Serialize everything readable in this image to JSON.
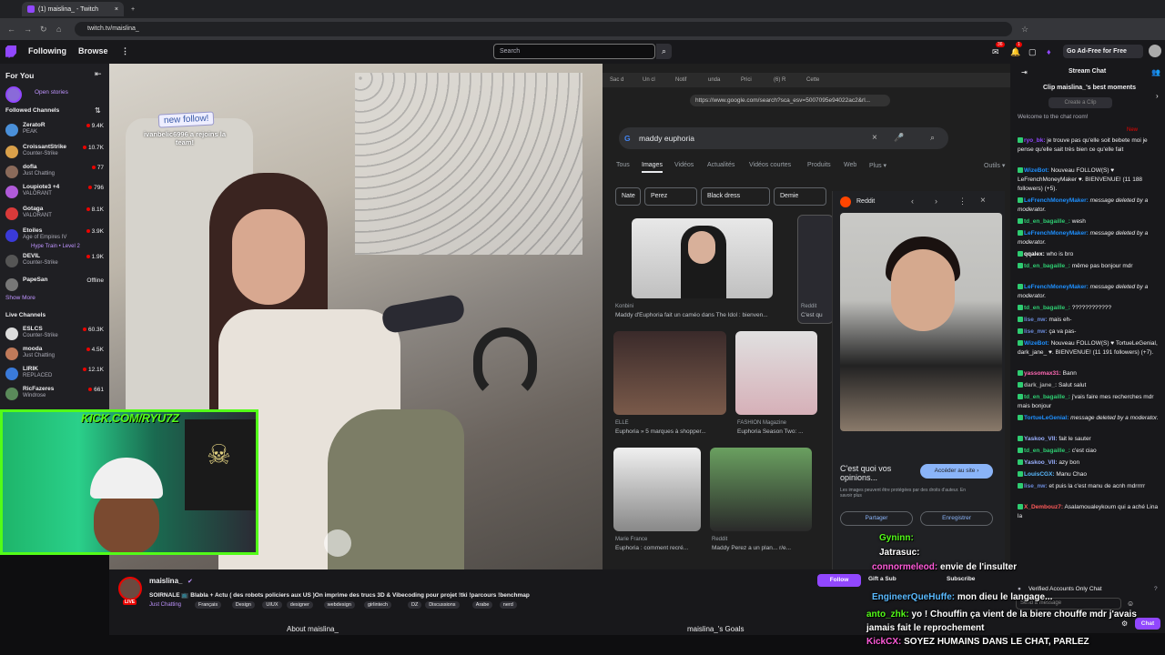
{
  "browser": {
    "tab_title": "(1) maislina_ - Twitch",
    "url": "twitch.tv/maislina_"
  },
  "twitch_nav": {
    "following": "Following",
    "browse": "Browse",
    "search_placeholder": "Search",
    "notif_count": "36",
    "notif_count2": "1",
    "adfree": "Go Ad-Free for Free"
  },
  "sidebar": {
    "for_you": "For You",
    "open_stories": "Open stories",
    "followed_header": "Followed Channels",
    "followed": [
      {
        "name": "ZeratoR",
        "game": "PEAK",
        "viewers": "9.4K",
        "color": "#4a90d9"
      },
      {
        "name": "CroissantStrike",
        "game": "Counter-Strike",
        "viewers": "10.7K",
        "color": "#d9a04a"
      },
      {
        "name": "dofla",
        "game": "Just Chatting",
        "viewers": "77",
        "color": "#8a6a5a"
      },
      {
        "name": "Loupiote3 +4",
        "game": "VALORANT",
        "viewers": "796",
        "color": "#b05ad9"
      },
      {
        "name": "Gotaga",
        "game": "VALORANT",
        "viewers": "8.1K",
        "color": "#d93a3a"
      },
      {
        "name": "Etoiles",
        "game": "Age of Empires IV",
        "viewers": "3.9K",
        "color": "#3a3ad9"
      },
      {
        "name": "DEVIL",
        "game": "Counter-Strike",
        "viewers": "1.9K",
        "color": "#555555"
      },
      {
        "name": "PapeSan",
        "game": "",
        "viewers": "Offline",
        "color": "#777777"
      }
    ],
    "hype_train": "Hype Train • Level 2",
    "show_more": "Show More",
    "live_header": "Live Channels",
    "live": [
      {
        "name": "ESLCS",
        "game": "Counter-Strike",
        "viewers": "60.3K",
        "color": "#dddddd"
      },
      {
        "name": "mooda",
        "game": "Just Chatting",
        "viewers": "4.5K",
        "color": "#c07a5a"
      },
      {
        "name": "LIRIK",
        "game": "REPLACED",
        "viewers": "12.1K",
        "color": "#3a7ad9"
      },
      {
        "name": "RicFazeres",
        "game": "Windrose",
        "viewers": "661",
        "color": "#5a8a5a"
      }
    ]
  },
  "stream_overlay": {
    "new_follow": "new follow!",
    "follow_note": "ivanbelic6996 a rejoins la team!"
  },
  "shared_screen": {
    "tabs": [
      "Sac d",
      "Un cl",
      "Notif",
      "unda",
      "Prici",
      "(6) R",
      "Cette"
    ],
    "url": "https://www.google.com/search?sca_esv=5007095e94022ac2&rl...",
    "query": "maddy euphoria",
    "gtabs": [
      "Tous",
      "Images",
      "Vidéos",
      "Actualités",
      "Vidéos courtes",
      "Produits",
      "Web",
      "Plus ▾",
      "Outils ▾"
    ],
    "chips": [
      "Nate",
      "Perez",
      "Black dress",
      "Demie"
    ],
    "results": [
      {
        "source": "Konbini",
        "caption": "Maddy d'Euphoria fait un caméo dans The Idol : bienven..."
      },
      {
        "source": "ELLE",
        "caption": "Euphoria » 5 marques à shopper..."
      },
      {
        "source": "FASHION Magazine",
        "caption": "Euphoria Season Two: ..."
      },
      {
        "source": "Marie France",
        "caption": "Euphoria : comment recré..."
      },
      {
        "source": "Reddit",
        "caption": "Maddy Perez a un plan... r/e..."
      }
    ],
    "side_source": "Reddit",
    "side_snip": "C'est qu",
    "panel_source": "Reddit",
    "opinion_title": "C'est quoi vos opinions...",
    "visit_site": "Accéder au site ›",
    "copyright": "Les images peuvent être protégées par des droits d'auteur. En savoir plus",
    "share": "Partager",
    "save": "Enregistrer"
  },
  "chat": {
    "header": "Stream Chat",
    "clip_banner": "Clip maislina_'s best moments",
    "create_clip": "Create a Clip",
    "welcome": "Welcome to the chat room!",
    "new_label": "New",
    "messages": [
      {
        "user": "ryo_bk:",
        "color": "#9147ff",
        "text": "je trouve pas qu'elle soit bebete moi je pense qu'elle sait très bien ce qu'elle fait",
        "lines": 3
      },
      {
        "user": "WizeBot:",
        "color": "#1e90ff",
        "text": "Nouveau FOLLOW(S) ♥ LeFrenchMoneyMaker ♥. BIENVENUE! (11 188 followers) (+5).",
        "lines": 3
      },
      {
        "user": "LeFrenchMoneyMaker:",
        "color": "#1e90ff",
        "text": "message deleted by a moderator.",
        "lines": 2
      },
      {
        "user": "td_en_bagaille_:",
        "color": "#2ecc71",
        "text": "wesh",
        "lines": 1
      },
      {
        "user": "LeFrenchMoneyMaker:",
        "color": "#1e90ff",
        "text": "message deleted by a moderator.",
        "lines": 2
      },
      {
        "user": "qqalex:",
        "color": "#ffffff",
        "text": "who is bro",
        "lines": 1
      },
      {
        "user": "td_en_bagaille_:",
        "color": "#2ecc71",
        "text": "même pas bonjour mdr",
        "lines": 2
      },
      {
        "user": "LeFrenchMoneyMaker:",
        "color": "#1e90ff",
        "text": "message deleted by a moderator.",
        "lines": 2
      },
      {
        "user": "td_en_bagaille_:",
        "color": "#2ecc71",
        "text": "????????????",
        "lines": 1
      },
      {
        "user": "lise_nw:",
        "color": "#6a8ad9",
        "text": "mais eh-",
        "lines": 1
      },
      {
        "user": "lise_nw:",
        "color": "#6a8ad9",
        "text": "ça va pas-",
        "lines": 1
      },
      {
        "user": "WizeBot:",
        "color": "#1e90ff",
        "text": "Nouveau FOLLOW(S) ♥ TortueLeGenial, dark_jane_ ♥. BIENVENUE! (11 191 followers) (+7).",
        "lines": 3
      },
      {
        "user": "yassomax31:",
        "color": "#ff69b4",
        "text": "Bann",
        "lines": 1
      },
      {
        "user": "dark_jane_:",
        "color": "#aaaaaa",
        "text": "Salut salut",
        "lines": 1
      },
      {
        "user": "td_en_bagaille_:",
        "color": "#2ecc71",
        "text": "j'vais faire mes recherches mdr mais bonjour",
        "lines": 2
      },
      {
        "user": "TortueLeGenial:",
        "color": "#1e90ff",
        "text": "message deleted by a moderator.",
        "lines": 2
      },
      {
        "user": "Yaskoo_VII:",
        "color": "#9ab0ff",
        "text": "fait le sauter",
        "lines": 1
      },
      {
        "user": "td_en_bagaille_:",
        "color": "#2ecc71",
        "text": "c'est ciao",
        "lines": 1
      },
      {
        "user": "Yaskoo_VII:",
        "color": "#9ab0ff",
        "text": "azy bon",
        "lines": 1
      },
      {
        "user": "LouisCGX:",
        "color": "#5abaff",
        "text": "Manu Chao",
        "lines": 1
      },
      {
        "user": "lise_nw:",
        "color": "#6a8ad9",
        "text": "et puis la c'est manu de acnh mdrrrrr",
        "lines": 2
      },
      {
        "user": "X_Dembouz7:",
        "color": "#ff5a5a",
        "text": "Asalamoualeykoum qui a aché Lina la",
        "lines": 2
      }
    ],
    "verified_only": "Verified Accounts Only Chat",
    "input_placeholder": "Send a message",
    "send": "Chat"
  },
  "kick_overlay": {
    "banner": "KICK.COM/RYU7Z",
    "lines": [
      {
        "user": "Gyninn:",
        "text": "",
        "color": "#53fc18"
      },
      {
        "user": "Jatrasuc:",
        "text": "",
        "color": "#ffffff"
      },
      {
        "user": "connormeleod:",
        "text": "envie de l'insulter",
        "color": "#ff5ad9"
      },
      {
        "user": "EngineerQueHuffe:",
        "text": "mon dieu le langage...",
        "color": "#5abaff"
      },
      {
        "user": "anto_zhk:",
        "text": "yo ! Chouffin ça vient de la biere chouffe mdr j'avais jamais fait le reprochement",
        "color": "#53fc18"
      },
      {
        "user": "KickCX:",
        "text": "SOYEZ HUMAINS DANS LE CHAT, PARLEZ",
        "color": "#ff5ad9"
      }
    ]
  },
  "stream_info": {
    "channel": "maislina_",
    "title": "SOIRNALE 📺 Blabla + Actu ( des robots policiers aux US )On imprime des trucs 3D & Vibecoding pour projet !tki !parcours !benchmap",
    "category": "Just Chatting",
    "tags": [
      "Français",
      "Design",
      "UIUX",
      "designer",
      "webdesign",
      "girlintech",
      "DZ",
      "Discussions",
      "Arabe",
      "nerd"
    ],
    "live": "LIVE",
    "follow": "Follow",
    "gift": "Gift a Sub",
    "subscribe": "Subscribe",
    "about": "About maislina_",
    "goals": "maislina_'s Goals"
  }
}
